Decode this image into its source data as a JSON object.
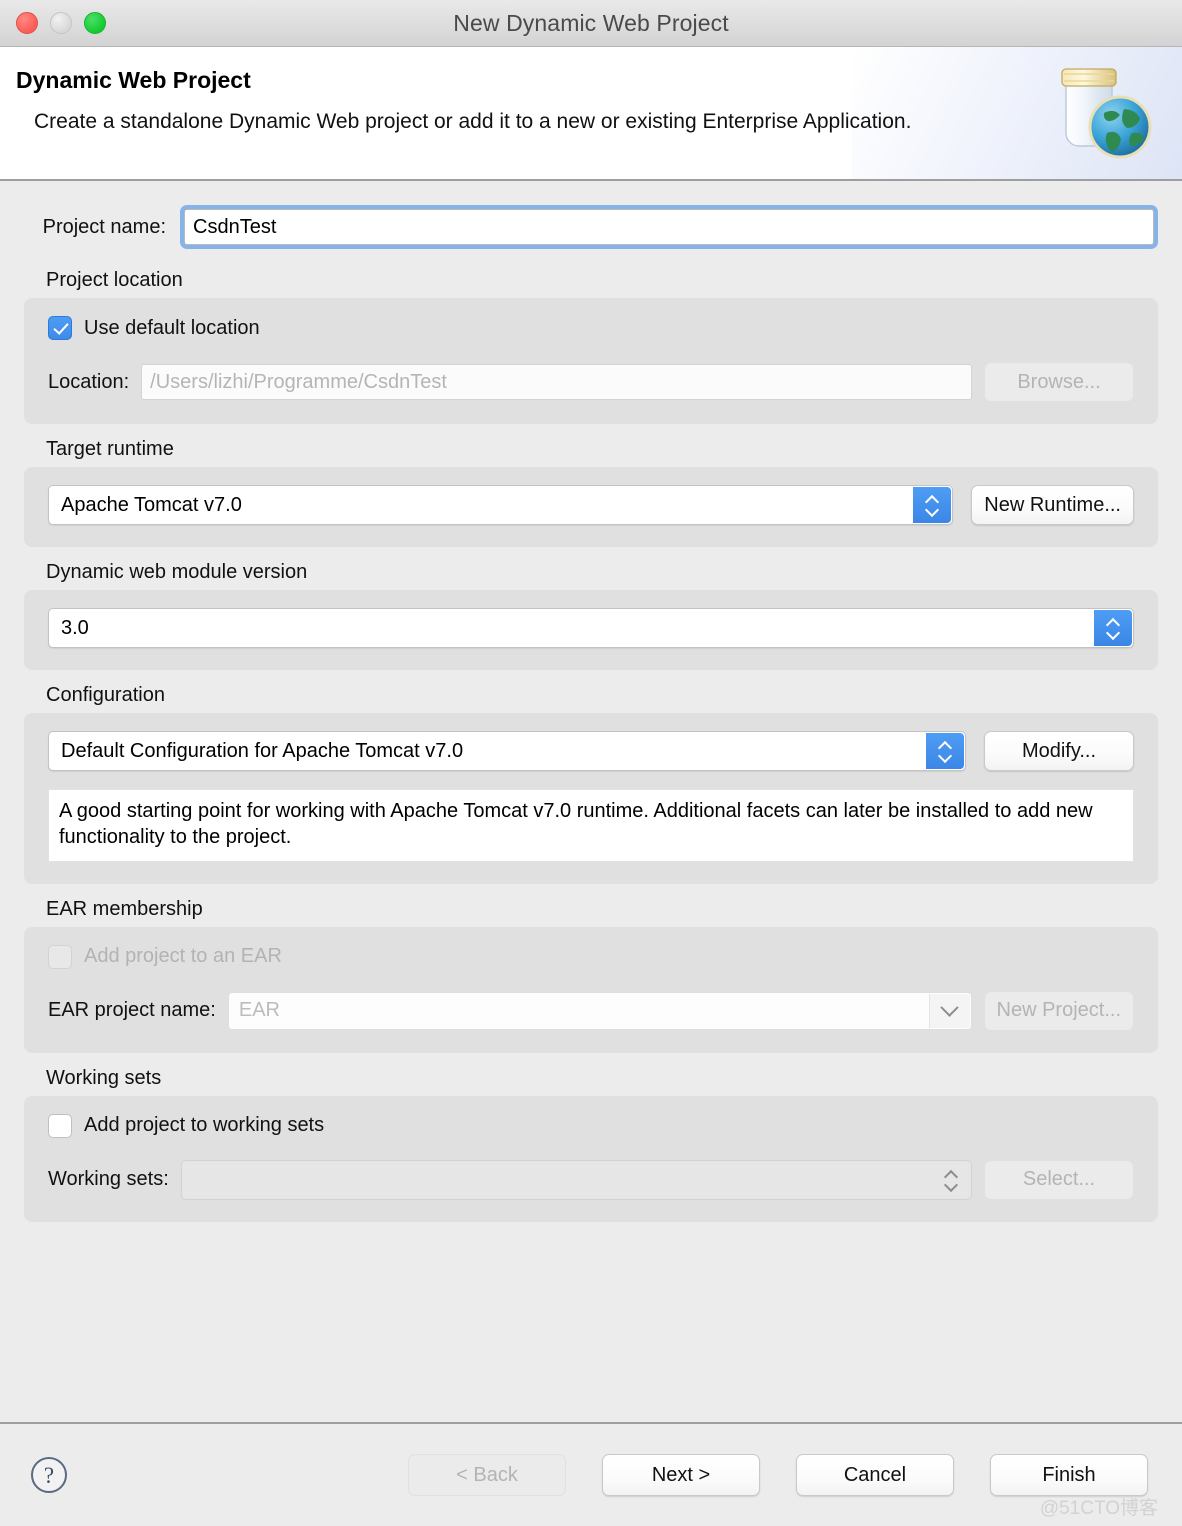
{
  "window": {
    "title": "New Dynamic Web Project",
    "traffic_lights": {
      "close": "close-button",
      "minimize": "minimize-button",
      "zoom": "zoom-button"
    }
  },
  "banner": {
    "title": "Dynamic Web Project",
    "subtitle": "Create a standalone Dynamic Web project or add it to a new or existing Enterprise Application.",
    "icon": "jar-globe-icon"
  },
  "form": {
    "project_name": {
      "label": "Project name:",
      "value": "CsdnTest",
      "placeholder": ""
    },
    "project_location": {
      "group_label": "Project location",
      "use_default_label": "Use default location",
      "use_default_checked": true,
      "location_label": "Location:",
      "location_value": "",
      "location_placeholder": "/Users/lizhi/Programme/CsdnTest",
      "browse_label": "Browse...",
      "browse_disabled": true
    },
    "target_runtime": {
      "group_label": "Target runtime",
      "selected": "Apache Tomcat v7.0",
      "new_runtime_label": "New Runtime..."
    },
    "module_version": {
      "group_label": "Dynamic web module version",
      "selected": "3.0"
    },
    "configuration": {
      "group_label": "Configuration",
      "selected": "Default Configuration for Apache Tomcat v7.0",
      "modify_label": "Modify...",
      "description": "A good starting point for working with Apache Tomcat v7.0 runtime. Additional facets can later be installed to add new functionality to the project."
    },
    "ear_membership": {
      "group_label": "EAR membership",
      "add_to_ear_label": "Add project to an EAR",
      "add_to_ear_checked": false,
      "add_to_ear_disabled": true,
      "ear_project_label": "EAR project name:",
      "ear_project_value": "",
      "ear_project_placeholder": "EAR",
      "new_project_label": "New Project...",
      "new_project_disabled": true
    },
    "working_sets": {
      "group_label": "Working sets",
      "add_to_working_sets_label": "Add project to working sets",
      "add_to_working_sets_checked": false,
      "working_sets_label": "Working sets:",
      "working_sets_value": "",
      "select_label": "Select...",
      "select_disabled": true
    }
  },
  "footer": {
    "help_icon": "help-icon",
    "back_label": "< Back",
    "back_disabled": true,
    "next_label": "Next >",
    "cancel_label": "Cancel",
    "finish_label": "Finish",
    "watermark": "@51CTO博客"
  },
  "colors": {
    "accent_blue": "#3f8ae8",
    "focus_ring": "#86b4e8",
    "dialog_bg": "#ececec",
    "group_bg": "#e0e0e0",
    "close_red": "#fc5b56",
    "zoom_green": "#16c92f"
  }
}
